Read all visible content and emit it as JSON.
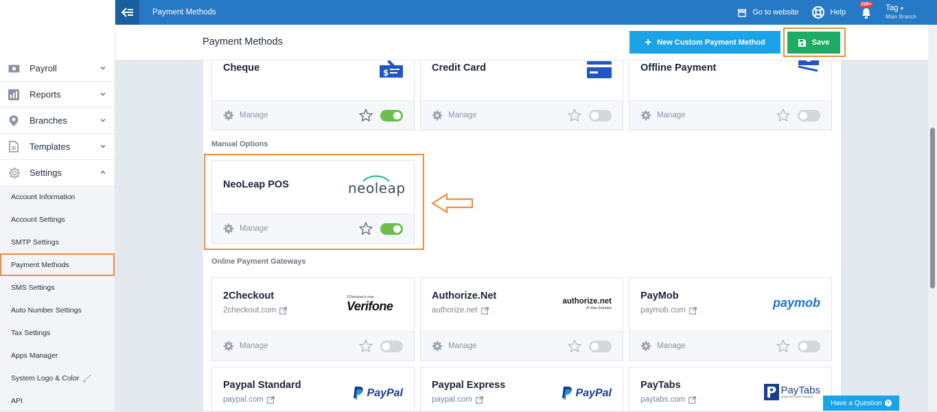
{
  "sidebar": {
    "main_items": [
      {
        "label": "Payroll",
        "icon": "money-icon",
        "expanded": false
      },
      {
        "label": "Reports",
        "icon": "chart-icon",
        "expanded": false
      },
      {
        "label": "Branches",
        "icon": "map-pin-icon",
        "expanded": false
      },
      {
        "label": "Templates",
        "icon": "document-icon",
        "expanded": false
      },
      {
        "label": "Settings",
        "icon": "gear-icon",
        "expanded": true
      }
    ],
    "settings_items": [
      "Account Information",
      "Account Settings",
      "SMTP Settings",
      "Payment Methods",
      "SMS Settings",
      "Auto Number Settings",
      "Tax Settings",
      "Apps Manager",
      "System Logo & Color",
      "API"
    ],
    "active_item": "Payment Methods"
  },
  "topbar": {
    "title": "Payment Methods",
    "go_to_website": "Go to website",
    "help": "Help",
    "notification_count": "226+",
    "user_name": "Tag",
    "user_branch": "Main Branch"
  },
  "header": {
    "title": "Payment Methods",
    "new_button": "New Custom Payment Method",
    "save_button": "Save"
  },
  "manage_label": "Manage",
  "sections": {
    "manual": "Manual Options",
    "online": "Online Payment Gateways"
  },
  "cards": {
    "cheque": {
      "name": "Cheque",
      "enabled": true
    },
    "credit_card": {
      "name": "Credit Card",
      "enabled": false
    },
    "offline": {
      "name": "Offline Payment",
      "enabled": false
    },
    "neoleap": {
      "name": "NeoLeap POS",
      "enabled": true,
      "logo_text": "neoleap"
    },
    "twocheckout": {
      "name": "2Checkout",
      "link": "2checkout.com",
      "enabled": false,
      "logo_text": "Verifone",
      "logo_small": "2Checkout is now"
    },
    "authorize": {
      "name": "Authorize.Net",
      "link": "authorize.net",
      "enabled": false,
      "logo_text": "authorize.net",
      "logo_small": "A Visa Solution"
    },
    "paymob": {
      "name": "PayMob",
      "link": "paymob.com",
      "enabled": false,
      "logo_text": "paymob"
    },
    "paypal_standard": {
      "name": "Paypal Standard",
      "link": "paypal.com",
      "logo_text": "PayPal"
    },
    "paypal_express": {
      "name": "Paypal Express",
      "link": "paypal.com",
      "logo_text": "PayPal"
    },
    "paytabs": {
      "name": "PayTabs",
      "link": "paytabs.com",
      "logo_text": "PayTabs",
      "logo_small": "Simple and Trusted Payments"
    }
  },
  "help_button": "Have a Question",
  "colors": {
    "topbar": "#2679c5",
    "accent_orange": "#f08c3a",
    "save_green": "#1eab64",
    "new_blue": "#1aa3e8",
    "toggle_on": "#6cc04a"
  }
}
